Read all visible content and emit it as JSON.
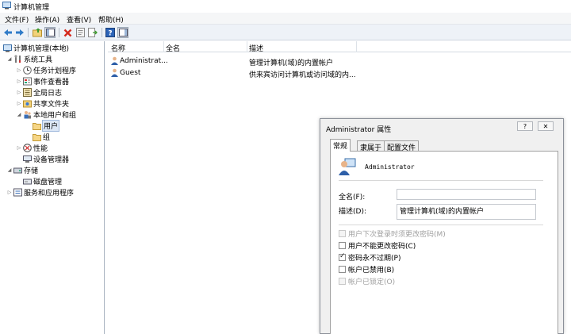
{
  "window": {
    "title": "计算机管理"
  },
  "menu": [
    {
      "label": "文件(F)",
      "name": "menu-file"
    },
    {
      "label": "操作(A)",
      "name": "menu-action"
    },
    {
      "label": "查看(V)",
      "name": "menu-view"
    },
    {
      "label": "帮助(H)",
      "name": "menu-help"
    }
  ],
  "toolbar": [
    {
      "name": "back-button",
      "icon": "arrow-left-icon"
    },
    {
      "name": "forward-button",
      "icon": "arrow-right-icon"
    },
    {
      "name": "up-folder-button",
      "icon": "folder-up-icon"
    },
    {
      "name": "show-hide-tree-button",
      "icon": "console-tree-icon"
    },
    {
      "name": "delete-button",
      "icon": "delete-x-icon"
    },
    {
      "name": "properties-button",
      "icon": "properties-icon"
    },
    {
      "name": "export-list-button",
      "icon": "export-icon"
    },
    {
      "name": "help-button",
      "icon": "help-icon"
    },
    {
      "name": "action-pane-button",
      "icon": "action-pane-icon"
    }
  ],
  "tree": {
    "root": "计算机管理(本地)",
    "items": [
      {
        "label": "系统工具",
        "name": "tree-system-tools",
        "icon": "tools-icon",
        "level": 1,
        "expander": "◢"
      },
      {
        "label": "任务计划程序",
        "name": "tree-task-scheduler",
        "icon": "clock-icon",
        "level": 2,
        "expander": "▷"
      },
      {
        "label": "事件查看器",
        "name": "tree-event-viewer",
        "icon": "event-viewer-icon",
        "level": 2,
        "expander": "▷"
      },
      {
        "label": "全局日志",
        "name": "tree-global-log",
        "icon": "log-icon",
        "level": 2,
        "expander": "▷"
      },
      {
        "label": "共享文件夹",
        "name": "tree-shared-folders",
        "icon": "shared-folder-icon",
        "level": 2,
        "expander": "▷"
      },
      {
        "label": "本地用户和组",
        "name": "tree-local-users-groups",
        "icon": "users-icon",
        "level": 2,
        "expander": "◢"
      },
      {
        "label": "用户",
        "name": "tree-users",
        "icon": "folder-icon",
        "level": 3,
        "expander": ""
      },
      {
        "label": "组",
        "name": "tree-groups",
        "icon": "folder-icon",
        "level": 3,
        "expander": ""
      },
      {
        "label": "性能",
        "name": "tree-performance",
        "icon": "performance-icon",
        "level": 2,
        "expander": "▷"
      },
      {
        "label": "设备管理器",
        "name": "tree-device-manager",
        "icon": "device-manager-icon",
        "level": 2,
        "expander": ""
      },
      {
        "label": "存储",
        "name": "tree-storage",
        "icon": "storage-icon",
        "level": 1,
        "expander": "◢"
      },
      {
        "label": "磁盘管理",
        "name": "tree-disk-management",
        "icon": "disk-icon",
        "level": 2,
        "expander": ""
      },
      {
        "label": "服务和应用程序",
        "name": "tree-services-apps",
        "icon": "services-icon",
        "level": 1,
        "expander": "▷"
      }
    ]
  },
  "list": {
    "columns": [
      "名称",
      "全名",
      "描述"
    ],
    "rows": [
      {
        "name": "Administrat...",
        "fullname": "",
        "desc": "管理计算机(域)的内置帐户"
      },
      {
        "name": "Guest",
        "fullname": "",
        "desc": "供来宾访问计算机或访问域的内..."
      }
    ]
  },
  "dialog": {
    "title": "Administrator 属性",
    "help_btn": "?",
    "close_btn": "✕",
    "tabs": [
      "常规",
      "隶属于",
      "配置文件"
    ],
    "username": "Administrator",
    "fullname_label": "全名(F):",
    "fullname_value": "",
    "desc_label": "描述(D):",
    "desc_value": "管理计算机(域)的内置帐户",
    "checkboxes": [
      {
        "label": "用户下次登录时须更改密码(M)",
        "checked": false,
        "disabled": true
      },
      {
        "label": "用户不能更改密码(C)",
        "checked": false,
        "disabled": false
      },
      {
        "label": "密码永不过期(P)",
        "checked": true,
        "disabled": false
      },
      {
        "label": "帐户已禁用(B)",
        "checked": false,
        "disabled": false
      },
      {
        "label": "帐户已锁定(O)",
        "checked": false,
        "disabled": true
      }
    ]
  }
}
